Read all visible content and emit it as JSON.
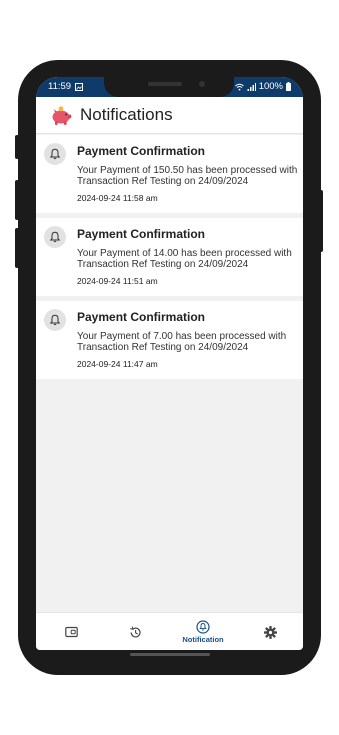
{
  "status_bar": {
    "time": "11:59",
    "battery": "100%"
  },
  "app_bar": {
    "title": "Notifications",
    "logo_icon": "piggy-bank-icon"
  },
  "notifications": [
    {
      "title": "Payment Confirmation",
      "message": "Your Payment of 150.50 has been processed with Transaction Ref Testing  on 24/09/2024",
      "time": "2024-09-24 11:58 am",
      "icon": "bell-icon"
    },
    {
      "title": "Payment Confirmation",
      "message": "Your Payment of 14.00 has been processed with Transaction Ref Testing  on 24/09/2024",
      "time": "2024-09-24 11:51 am",
      "icon": "bell-icon"
    },
    {
      "title": "Payment Confirmation",
      "message": "Your Payment of 7.00 has been processed with Transaction Ref Testing  on 24/09/2024",
      "time": "2024-09-24 11:47 am",
      "icon": "bell-icon"
    }
  ],
  "bottom_nav": {
    "items": [
      {
        "icon": "wallet-icon",
        "label": "",
        "active": false
      },
      {
        "icon": "history-icon",
        "label": "",
        "active": false
      },
      {
        "icon": "notification-icon",
        "label": "Notification",
        "active": true
      },
      {
        "icon": "settings-icon",
        "label": "",
        "active": false
      }
    ]
  },
  "colors": {
    "status_bar": "#0e3b6a",
    "accent": "#1c4e86",
    "background": "#f1f1f2",
    "card": "#ffffff"
  }
}
